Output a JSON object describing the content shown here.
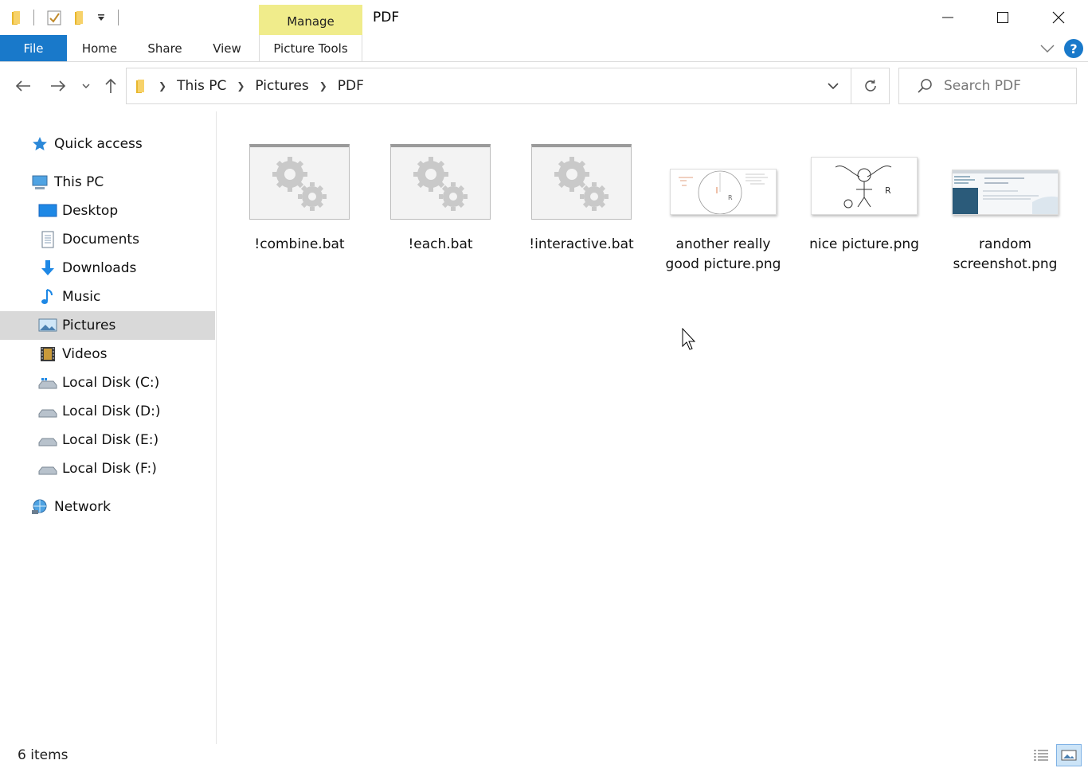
{
  "window": {
    "title": "PDF"
  },
  "ribbon": {
    "contextual_group": "Manage",
    "tabs": [
      "File",
      "Home",
      "Share",
      "View",
      "Picture Tools"
    ]
  },
  "address": {
    "crumbs": [
      "This PC",
      "Pictures",
      "PDF"
    ]
  },
  "search": {
    "placeholder": "Search PDF"
  },
  "nav": {
    "quick_access": "Quick access",
    "this_pc": "This PC",
    "items": [
      "Desktop",
      "Documents",
      "Downloads",
      "Music",
      "Pictures",
      "Videos",
      "Local Disk (C:)",
      "Local Disk (D:)",
      "Local Disk (E:)",
      "Local Disk (F:)"
    ],
    "network": "Network",
    "selected": "Pictures"
  },
  "files": [
    {
      "name": "!combine.bat",
      "kind": "bat"
    },
    {
      "name": "!each.bat",
      "kind": "bat"
    },
    {
      "name": "!interactive.bat",
      "kind": "bat"
    },
    {
      "name": "another really good picture.png",
      "kind": "png"
    },
    {
      "name": "nice picture.png",
      "kind": "png"
    },
    {
      "name": "random screenshot.png",
      "kind": "png"
    }
  ],
  "status": {
    "item_count": "6 items"
  },
  "colors": {
    "file_tab": "#1979ca",
    "manage_tab": "#f0ec8b",
    "selection": "#d9d9d9"
  }
}
